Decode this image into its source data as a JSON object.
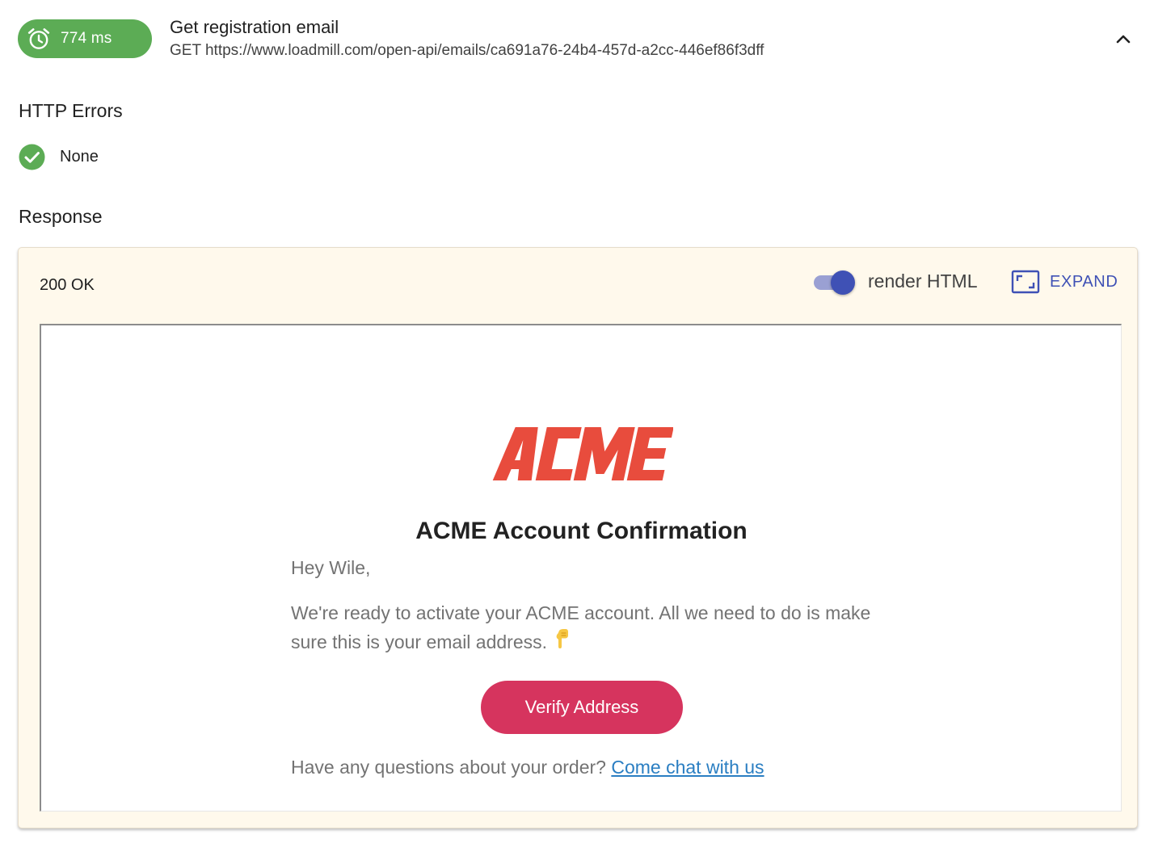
{
  "request": {
    "duration": "774 ms",
    "title": "Get registration email",
    "url": "GET https://www.loadmill.com/open-api/emails/ca691a76-24b4-457d-a2cc-446ef86f3dff",
    "timing_icon": "alarm-clock-icon",
    "collapse_icon": "chevron-up-icon",
    "pill_color": "#5cac55"
  },
  "http_errors": {
    "heading": "HTTP Errors",
    "status_icon": "check-circle-icon",
    "status_text": "None",
    "status_color": "#5cac55"
  },
  "response": {
    "heading": "Response",
    "status": "200 OK",
    "render_html": {
      "label": "render HTML",
      "enabled": true
    },
    "expand": {
      "label": "EXPAND",
      "icon": "expand-frame-icon"
    },
    "accent_color": "#3f51b5",
    "panel_color": "#fff9ec"
  },
  "email": {
    "logo_text": "ACME",
    "logo_color": "#e84c3d",
    "title": "ACME Account Confirmation",
    "greeting": "Hey Wile,",
    "message": "We're ready to activate your ACME account. All we need to do is make sure this is your email address.",
    "emoji": "👇",
    "verify_button": "Verify Address",
    "button_color": "#d6345e",
    "footer_text": "Have any questions about your order?",
    "footer_link": "Come chat with us",
    "link_color": "#2a7ec2"
  }
}
